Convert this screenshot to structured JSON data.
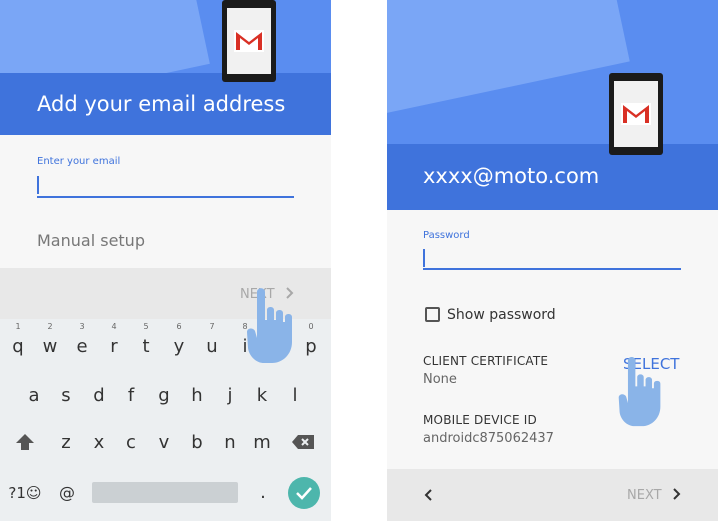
{
  "left": {
    "header_title": "Add your email address",
    "email_label": "Enter your email",
    "manual_setup": "Manual setup",
    "next_label": "NEXT",
    "keyboard": {
      "row1": [
        {
          "key": "q",
          "num": "1"
        },
        {
          "key": "w",
          "num": "2"
        },
        {
          "key": "e",
          "num": "3"
        },
        {
          "key": "r",
          "num": "4"
        },
        {
          "key": "t",
          "num": "5"
        },
        {
          "key": "y",
          "num": "6"
        },
        {
          "key": "u",
          "num": "7"
        },
        {
          "key": "i",
          "num": "8"
        },
        {
          "key": "o",
          "num": "9"
        },
        {
          "key": "p",
          "num": "0"
        }
      ],
      "row2": [
        "a",
        "s",
        "d",
        "f",
        "g",
        "h",
        "j",
        "k",
        "l"
      ],
      "row3": [
        "z",
        "x",
        "c",
        "v",
        "b",
        "n",
        "m"
      ],
      "symbols_key": "?1☺",
      "at_key": "@",
      "period_key": "."
    }
  },
  "right": {
    "header_title": "xxxx@moto.com",
    "password_label": "Password",
    "show_password_label": "Show password",
    "client_cert_label": "CLIENT CERTIFICATE",
    "client_cert_value": "None",
    "select_label": "SELECT",
    "device_id_label": "MOBILE DEVICE ID",
    "device_id_value": "androidc875062437",
    "next_label": "NEXT"
  },
  "colors": {
    "header_light": "#7aa6f6",
    "header_band": "#3f73dc",
    "accent": "#3f73dc",
    "enter_key": "#4db6ac",
    "hand": "#8ab4e8"
  },
  "icons": [
    "gmail-icon",
    "chevron-right-icon",
    "chevron-left-icon",
    "shift-icon",
    "backspace-icon",
    "check-icon",
    "tap-hand-icon"
  ]
}
